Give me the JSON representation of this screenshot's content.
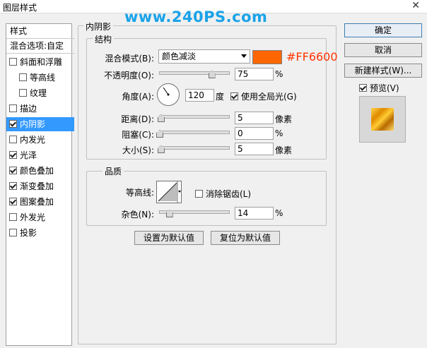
{
  "window": {
    "title": "图层样式",
    "close_glyph": "✕"
  },
  "watermark": "www.240PS.com",
  "sidebar": {
    "header": "样式",
    "blend_options": "混合选项:自定",
    "items": [
      {
        "label": "斜面和浮雕",
        "checked": false,
        "indent": false
      },
      {
        "label": "等高线",
        "checked": false,
        "indent": true
      },
      {
        "label": "纹理",
        "checked": false,
        "indent": true
      },
      {
        "label": "描边",
        "checked": false,
        "indent": false
      },
      {
        "label": "内阴影",
        "checked": true,
        "indent": false,
        "selected": true
      },
      {
        "label": "内发光",
        "checked": false,
        "indent": false
      },
      {
        "label": "光泽",
        "checked": true,
        "indent": false
      },
      {
        "label": "颜色叠加",
        "checked": true,
        "indent": false
      },
      {
        "label": "渐变叠加",
        "checked": true,
        "indent": false
      },
      {
        "label": "图案叠加",
        "checked": true,
        "indent": false
      },
      {
        "label": "外发光",
        "checked": false,
        "indent": false
      },
      {
        "label": "投影",
        "checked": false,
        "indent": false
      }
    ]
  },
  "panel": {
    "title": "内阴影",
    "structure": {
      "title": "结构",
      "blend_mode_label": "混合模式(B):",
      "blend_mode_value": "颜色减淡",
      "color": "#FF6600",
      "color_annotation": "#FF6600",
      "opacity_label": "不透明度(O):",
      "opacity_value": "75",
      "opacity_unit": "%",
      "angle_label": "角度(A):",
      "angle_value": "120",
      "angle_unit": "度",
      "global_light_label": "使用全局光(G)",
      "global_light_checked": true,
      "distance_label": "距离(D):",
      "distance_value": "5",
      "distance_unit": "像素",
      "choke_label": "阻塞(C):",
      "choke_value": "0",
      "choke_unit": "%",
      "size_label": "大小(S):",
      "size_value": "5",
      "size_unit": "像素"
    },
    "quality": {
      "title": "品质",
      "contour_label": "等高线:",
      "antialias_label": "消除锯齿(L)",
      "antialias_checked": false,
      "noise_label": "杂色(N):",
      "noise_value": "14",
      "noise_unit": "%"
    },
    "make_default": "设置为默认值",
    "reset_default": "复位为默认值"
  },
  "buttons": {
    "ok": "确定",
    "cancel": "取消",
    "new_style": "新建样式(W)...",
    "preview_label": "预览(V)",
    "preview_checked": true
  },
  "sliders": {
    "opacity": 0.75,
    "distance": 0.02,
    "choke": 0.0,
    "size": 0.02,
    "noise": 0.14
  }
}
